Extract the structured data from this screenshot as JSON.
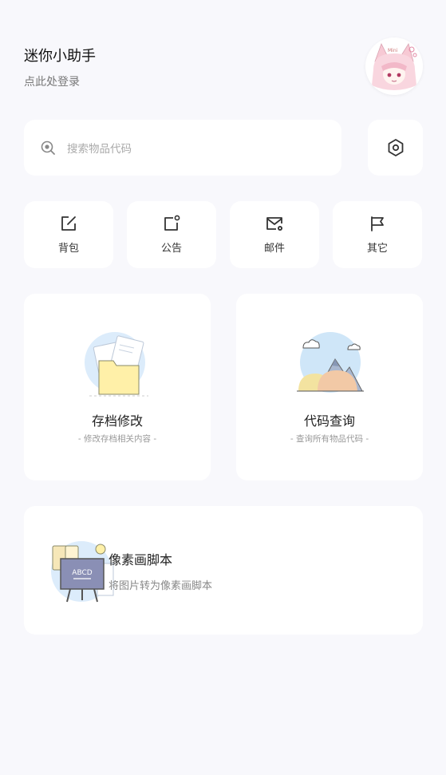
{
  "header": {
    "title": "迷你小助手",
    "login_hint": "点此处登录"
  },
  "avatar": {
    "icon": "anime-cat-girl-avatar",
    "signature": "Mini"
  },
  "search": {
    "placeholder": "搜索物品代码",
    "icon": "search-icon"
  },
  "settings": {
    "icon": "hexagon-gear-icon"
  },
  "quick_actions": [
    {
      "label": "背包",
      "icon": "edit-square-icon"
    },
    {
      "label": "公告",
      "icon": "notice-icon"
    },
    {
      "label": "邮件",
      "icon": "mail-settings-icon"
    },
    {
      "label": "其它",
      "icon": "flag-icon"
    }
  ],
  "features": [
    {
      "title": "存档修改",
      "subtitle": "- 修改存档相关内容 -",
      "icon": "folder-illustration"
    },
    {
      "title": "代码查询",
      "subtitle": "- 查询所有物品代码 -",
      "icon": "mountain-illustration"
    }
  ],
  "pixel_script": {
    "title": "像素画脚本",
    "subtitle": "将图片转为像素画脚本",
    "icon": "chalkboard-illustration",
    "board_text": "ABCD"
  },
  "colors": {
    "background": "#f8f8fc",
    "card": "#ffffff",
    "icon": "#333333",
    "folder": "#fff0a8"
  }
}
